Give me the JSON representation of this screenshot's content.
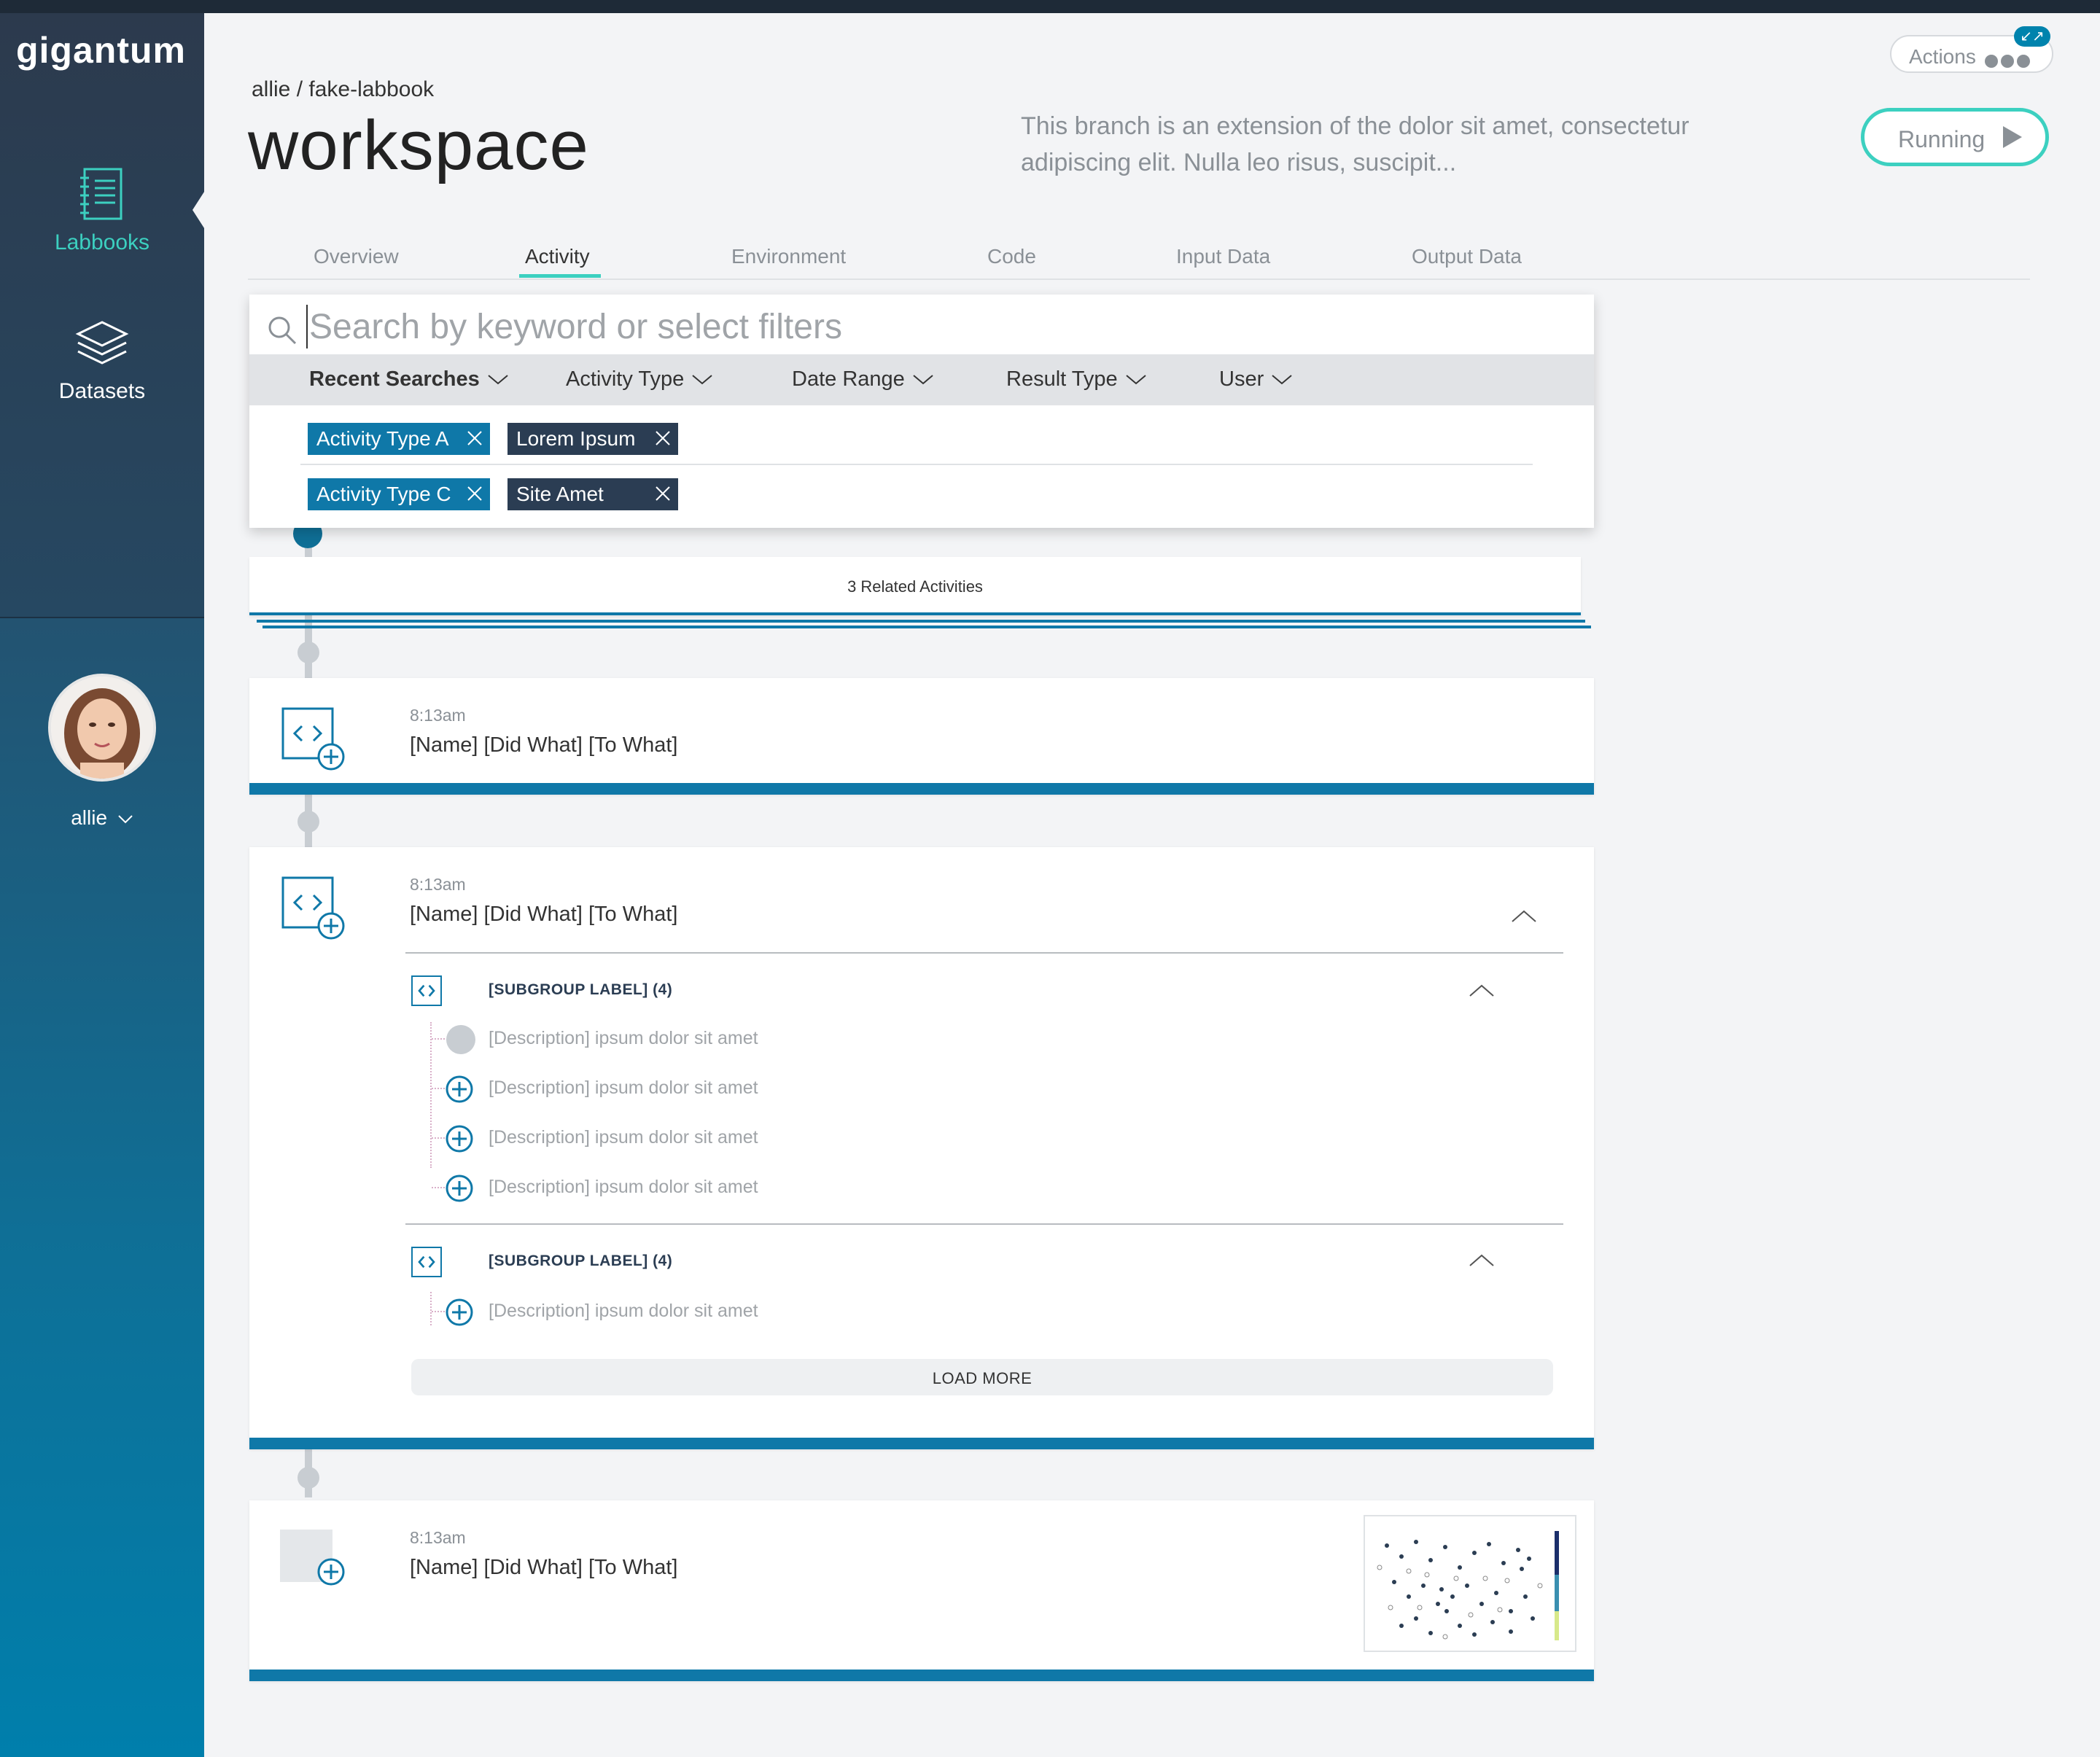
{
  "app": {
    "logo": "gigantum"
  },
  "sidebar": {
    "items": [
      {
        "label": "Labbooks",
        "icon": "notebook-icon",
        "active": true
      },
      {
        "label": "Datasets",
        "icon": "layers-icon",
        "active": false
      }
    ],
    "user": {
      "name": "allie"
    }
  },
  "header": {
    "breadcrumb": "allie / fake-labbook",
    "title": "workspace",
    "description": "This branch is an extension of the dolor sit amet, consectetur adipiscing elit. Nulla leo risus, suscipit...",
    "actions_label": "Actions",
    "status_label": "Running"
  },
  "tabs": [
    "Overview",
    "Activity",
    "Environment",
    "Code",
    "Input Data",
    "Output Data"
  ],
  "active_tab": "Activity",
  "search": {
    "placeholder": "Search by keyword or select filters",
    "filters": [
      "Recent Searches",
      "Activity Type",
      "Date Range",
      "Result Type",
      "User"
    ],
    "chips_row1": [
      {
        "label": "Activity Type A",
        "style": "blue"
      },
      {
        "label": "Lorem Ipsum",
        "style": "dark"
      }
    ],
    "chips_row2": [
      {
        "label": "Activity Type C",
        "style": "blue"
      },
      {
        "label": "Site Amet",
        "style": "dark"
      }
    ]
  },
  "related": {
    "label": "3 Related Activities"
  },
  "cards": [
    {
      "time": "8:13am",
      "headline": "[Name] [Did What] [To What]"
    },
    {
      "time": "8:13am",
      "headline": "[Name] [Did What] [To What]",
      "subgroups": [
        {
          "label": "[SUBGROUP LABEL] (4)",
          "items": [
            "[Description] ipsum dolor sit amet",
            "[Description] ipsum dolor sit amet",
            "[Description] ipsum dolor sit amet",
            "[Description] ipsum dolor sit amet"
          ]
        },
        {
          "label": "[SUBGROUP LABEL] (4)",
          "items": [
            "[Description] ipsum dolor sit amet"
          ]
        }
      ],
      "load_more": "LOAD MORE"
    },
    {
      "time": "8:13am",
      "headline": "[Name] [Did What] [To What]"
    }
  ],
  "colors": {
    "accent": "#3cd0c0",
    "primary": "#0f78a8",
    "dark": "#2b3d53"
  }
}
